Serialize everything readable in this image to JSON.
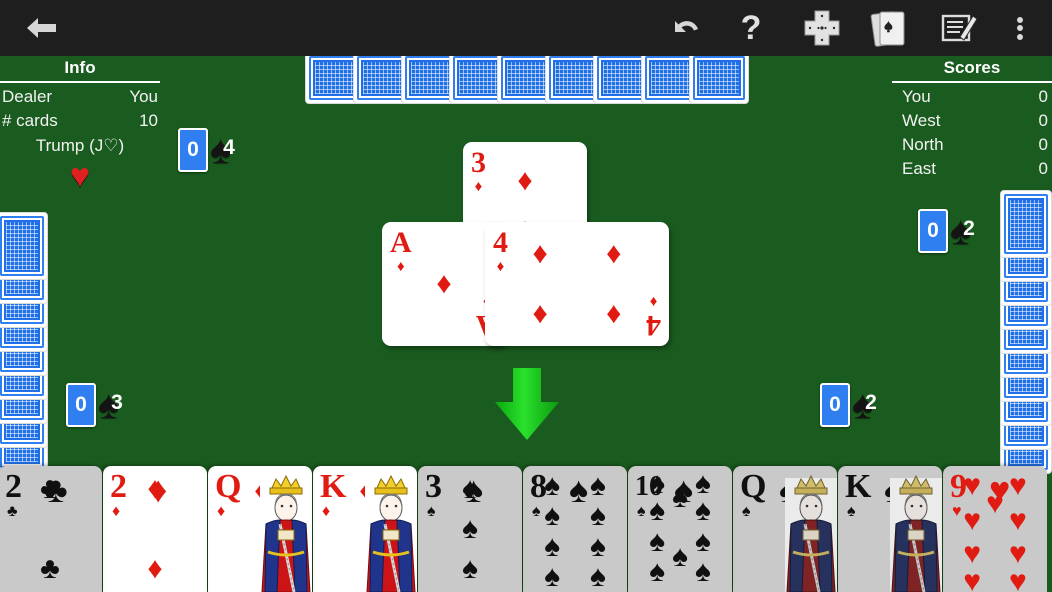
{
  "app": {
    "title": "Spades",
    "table_color": "#1a5c1f",
    "accent_blue": "#2f7ff0"
  },
  "toolbar": {
    "back_label": "Back",
    "items": [
      {
        "name": "undo-icon",
        "label": "Undo"
      },
      {
        "name": "help-icon",
        "label": "?"
      },
      {
        "name": "table-layout-icon",
        "label": "Table layout"
      },
      {
        "name": "cards-icon",
        "label": "Cards"
      },
      {
        "name": "scorecard-icon",
        "label": "Scorecard"
      },
      {
        "name": "overflow-menu-icon",
        "label": "More options"
      }
    ]
  },
  "info": {
    "title": "Info",
    "rows": [
      {
        "label": "Dealer",
        "value": "You"
      },
      {
        "label": "# cards",
        "value": "10"
      }
    ],
    "trump_label": "Trump (J♡)",
    "trump_suit_glyph": "♥",
    "trump_suit_color": "#e01b12"
  },
  "scores": {
    "title": "Scores",
    "rows": [
      {
        "label": "You",
        "value": "0"
      },
      {
        "label": "West",
        "value": "0"
      },
      {
        "label": "North",
        "value": "0"
      },
      {
        "label": "East",
        "value": "0"
      }
    ]
  },
  "bids": {
    "north": {
      "bid": "0",
      "tricks": "4"
    },
    "west": {
      "bid": "0",
      "tricks": "3"
    },
    "east": {
      "bid": "0",
      "tricks": "2"
    },
    "south": {
      "bid": "0",
      "tricks": "2"
    }
  },
  "hands": {
    "north_card_count": 9,
    "west_card_count": 10,
    "east_card_count": 10
  },
  "trick": {
    "cards": [
      {
        "seat": "north",
        "rank": "3",
        "suit": "♦",
        "color": "#e01b12",
        "pips": 3
      },
      {
        "seat": "west",
        "rank": "A",
        "suit": "♦",
        "color": "#e01b12",
        "pips": 1
      },
      {
        "seat": "east",
        "rank": "4",
        "suit": "♦",
        "color": "#e01b12",
        "pips": 4
      }
    ]
  },
  "turn_indicator": {
    "direction": "down",
    "points_to": "south",
    "color": "#16c419"
  },
  "player_hand": {
    "cards": [
      {
        "rank": "2",
        "suit": "♣",
        "color": "#101010",
        "playable": false,
        "face": false
      },
      {
        "rank": "2",
        "suit": "♦",
        "color": "#e01b12",
        "playable": true,
        "face": false
      },
      {
        "rank": "Q",
        "suit": "♦",
        "color": "#e01b12",
        "playable": true,
        "face": true
      },
      {
        "rank": "K",
        "suit": "♦",
        "color": "#e01b12",
        "playable": true,
        "face": true
      },
      {
        "rank": "3",
        "suit": "♠",
        "color": "#101010",
        "playable": false,
        "face": false
      },
      {
        "rank": "8",
        "suit": "♠",
        "color": "#101010",
        "playable": false,
        "face": false
      },
      {
        "rank": "10",
        "suit": "♠",
        "color": "#101010",
        "playable": false,
        "face": false
      },
      {
        "rank": "Q",
        "suit": "♠",
        "color": "#101010",
        "playable": false,
        "face": true
      },
      {
        "rank": "K",
        "suit": "♠",
        "color": "#101010",
        "playable": false,
        "face": true
      },
      {
        "rank": "9",
        "suit": "♥",
        "color": "#e01b12",
        "playable": false,
        "face": false
      }
    ]
  }
}
